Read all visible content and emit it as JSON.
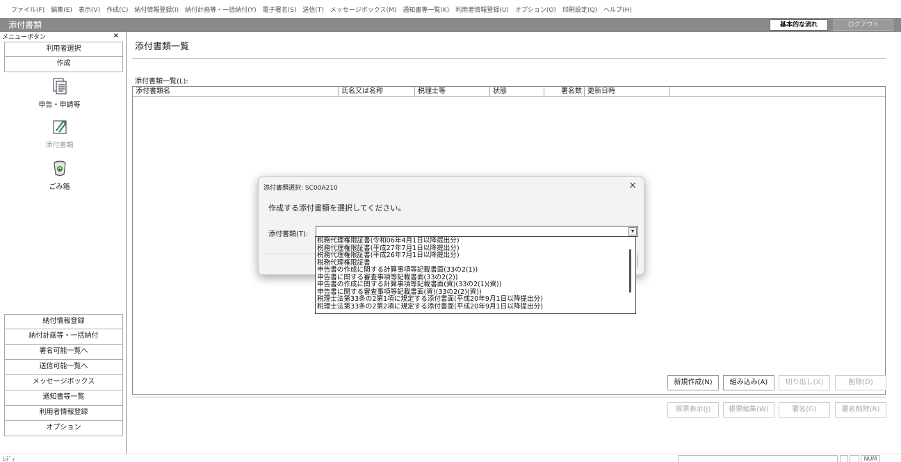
{
  "menubar": [
    "ファイル(F)",
    "編集(E)",
    "表示(V)",
    "作成(C)",
    "納付情報登録(I)",
    "納付計画等・一括納付(Y)",
    "電子署名(S)",
    "送信(T)",
    "メッセージボックス(M)",
    "通知書等一覧(K)",
    "利用者情報登録(U)",
    "オプション(O)",
    "印刷設定(Q)",
    "ヘルプ(H)"
  ],
  "window": {
    "title": "添付書類",
    "flow_button": "基本的な流れ",
    "logout_button": "ログアウト"
  },
  "sidebar": {
    "header": "メニューボタン",
    "close": "×",
    "top_buttons": [
      "利用者選択",
      "作成"
    ],
    "icons": [
      {
        "label": "申告・申請等",
        "icon": "document-icon"
      },
      {
        "label": "添付書類",
        "icon": "attachment-icon"
      },
      {
        "label": "ごみ箱",
        "icon": "trash-icon"
      }
    ],
    "bottom_buttons": [
      "納付情報登録",
      "納付計画等・一括納付",
      "署名可能一覧へ",
      "送信可能一覧へ",
      "メッセージボックス",
      "通知書等一覧",
      "利用者情報登録",
      "オプション"
    ]
  },
  "main": {
    "page_title": "添付書類一覧",
    "list_label": "添付書類一覧(L):",
    "columns": [
      "添付書類名",
      "氏名又は名称",
      "税理士等",
      "状態",
      "署名数",
      "更新日時"
    ],
    "buttons_row1": [
      "新規作成(N)",
      "組み込み(A)",
      "切り出し(X)",
      "削除(D)"
    ],
    "buttons_row2": [
      "帳票表示(J)",
      "帳票編集(W)",
      "署名(G)",
      "署名削除(R)"
    ]
  },
  "dialog": {
    "title": "添付書類選択: SC00A210",
    "close": "×",
    "prompt": "作成する添付書類を選択してください。",
    "field_label": "添付書類(T):",
    "value": "",
    "arrow": "▾",
    "options": [
      "税務代理権限証書(令和06年4月1日以降提出分)",
      "税務代理権限証書(平成27年7月1日以降提出分)",
      "税務代理権限証書(平成26年7月1日以降提出分)",
      "税務代理権限証書",
      "申告書の作成に関する計算事項等記載書面(33の2(1))",
      "申告書に関する審査事項等記載書面(33の2(2))",
      "申告書の作成に関する計算事項等記載書面(資)(33の2(1)(資))",
      "申告書に関する審査事項等記載書面(資)(33の2(2)(資))",
      "税理士法第33条の2第1項に規定する添付書面(平成20年9月1日以降提出分)",
      "税理士法第33条の2第2項に規定する添付書面(平成20年9月1日以降提出分)"
    ]
  },
  "status": {
    "ready": "ﾚﾃﾞｨ",
    "num": "NUM"
  }
}
